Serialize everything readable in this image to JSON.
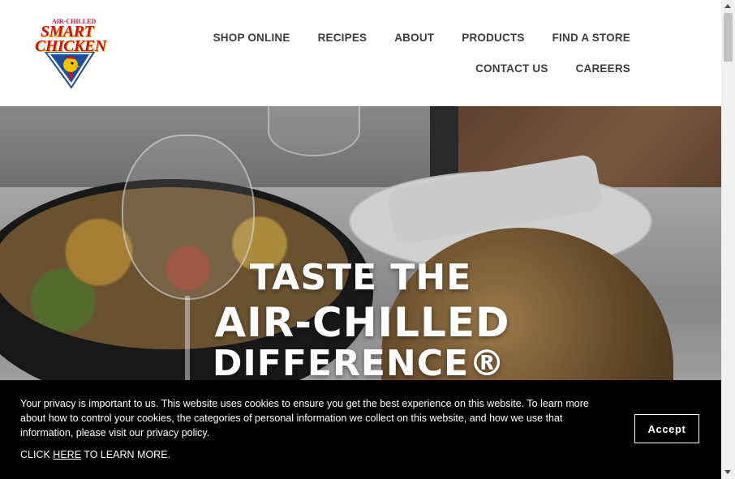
{
  "brand": {
    "logo_top": "AIR-CHILLED",
    "logo_line1": "SMART",
    "logo_line2": "CHICKEN"
  },
  "nav": {
    "row1": [
      "SHOP ONLINE",
      "RECIPES",
      "ABOUT",
      "PRODUCTS",
      "FIND A STORE"
    ],
    "row2": [
      "CONTACT US",
      "CAREERS"
    ]
  },
  "hero": {
    "line1": "TASTE THE",
    "line2": "AIR-CHILLED",
    "line3": "DIFFERENCE®"
  },
  "cookie_banner": {
    "text": "Your privacy is important to us.  This website uses cookies to ensure you get the best experience on this website. To learn more about how to control your cookies, the categories of personal information we collect on this website, and how we use that information, please visit our privacy policy.",
    "more_prefix": "CLICK ",
    "more_link": "HERE",
    "more_suffix": " TO LEARN MORE.",
    "accept_label": "Accept"
  },
  "colors": {
    "brand_red": "#c8102e",
    "brand_yellow": "#f2c400",
    "nav_text": "#3d3d3d",
    "banner_bg": "#000000"
  }
}
